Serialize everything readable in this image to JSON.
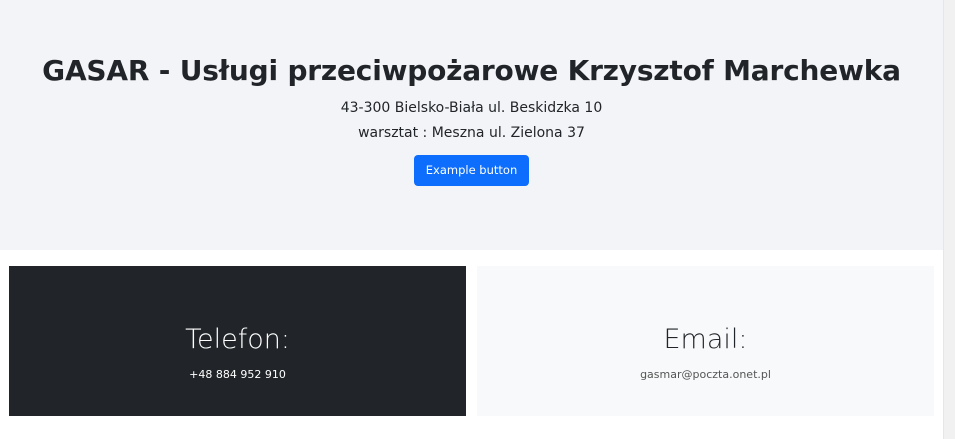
{
  "hero": {
    "title": "GASAR - Usługi przeciwpożarowe Krzysztof Marchewka",
    "address_line1": "43-300 Bielsko-Biała ul. Beskidzka 10",
    "address_line2": "warsztat : Meszna ul. Zielona 37",
    "button_label": "Example button"
  },
  "contacts": {
    "phone": {
      "title": "Telefon:",
      "value": "+48 884 952 910"
    },
    "email": {
      "title": "Email:",
      "value": "gasmar@poczta.onet.pl"
    }
  },
  "colors": {
    "primary": "#0d6efd",
    "dark": "#212529",
    "light": "#f8f9fa",
    "hero_bg": "#f3f4f7"
  }
}
